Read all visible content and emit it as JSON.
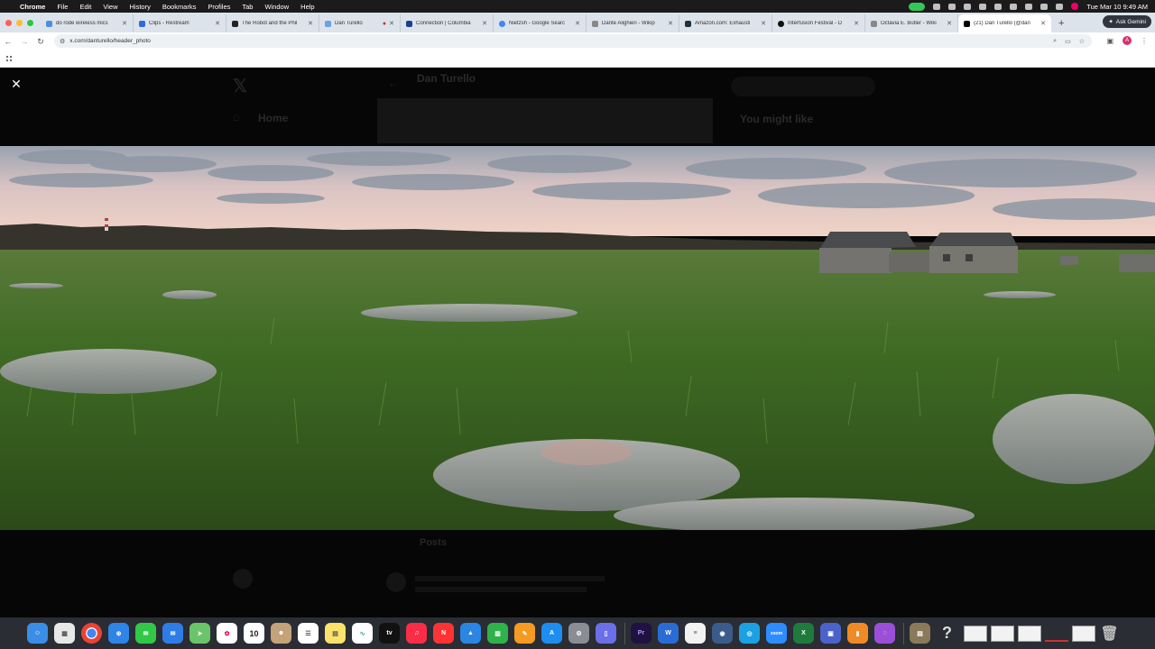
{
  "menubar": {
    "app": "Chrome",
    "items": [
      "File",
      "Edit",
      "View",
      "History",
      "Bookmarks",
      "Profiles",
      "Tab",
      "Window",
      "Help"
    ],
    "datetime": "Tue Mar 10  9:49 AM"
  },
  "tabs": [
    {
      "title": "do rode wireless mics"
    },
    {
      "title": "Clips - Restream"
    },
    {
      "title": "The Robot and the Phil"
    },
    {
      "title": "Dan Turello"
    },
    {
      "title": "Connection | Columbia"
    },
    {
      "title": "Nietzsh - Google Searc"
    },
    {
      "title": "Dante Alighieri - Wikip"
    },
    {
      "title": "Amazon.com: Exhausti"
    },
    {
      "title": "Interfusion Festival - D"
    },
    {
      "title": "Octavia E. Butler - Wiki"
    },
    {
      "title": "(21) Dan Turello (@dan"
    }
  ],
  "gemini_label": "Ask Gemini",
  "address": {
    "url": "x.com/danturello/header_photo"
  },
  "avatar_letter": "A",
  "background_page": {
    "profile_name": "Dan Turello",
    "nav_home": "Home",
    "sidebar_heading": "You might like",
    "tab_posts": "Posts"
  },
  "colors": {
    "menubar": "#1b1b1b",
    "tabstrip": "#dde3ea",
    "overlay": "#060606",
    "dock": "#2a2d33"
  },
  "dock": {
    "calendar_day": "10",
    "tv_label": "tv",
    "zoom_label": "zoom",
    "premiere_label": "Pr",
    "help_glyph": "?"
  },
  "icons": [
    "apple-icon",
    "close-icon",
    "back-icon",
    "forward-icon",
    "reload-icon",
    "site-settings-icon",
    "zoom-icon",
    "cast-icon",
    "bookmark-star-icon",
    "extensions-icon",
    "menu-icon",
    "apps-grid-icon"
  ]
}
